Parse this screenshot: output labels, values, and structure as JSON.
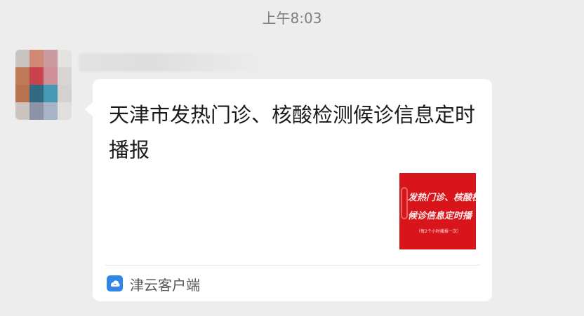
{
  "timestamp": "上午8:03",
  "avatar": {
    "pixel_colors": [
      "#c9c4c0",
      "#d18975",
      "#c99a9f",
      "#e6e2e0",
      "#bf7a57",
      "#c9434c",
      "#cf8f99",
      "#d9d6d4",
      "#b77350",
      "#2f6a80",
      "#4699b3",
      "#d4d2d0",
      "#ccc4bf",
      "#8c93a6",
      "#a6b3c9",
      "#e0dfde"
    ]
  },
  "message": {
    "title": "天津市发热门诊、核酸检测候诊信息定时播报",
    "thumbnail": {
      "line1": "发热门诊、核酸检",
      "line2": "候诊信息定时播",
      "line3": "（每2个小时播报一次）",
      "bg_color": "#d8151a"
    },
    "source": {
      "icon": "jinyun-app-icon",
      "name": "津云客户端",
      "icon_color": "#2f86e6"
    }
  }
}
